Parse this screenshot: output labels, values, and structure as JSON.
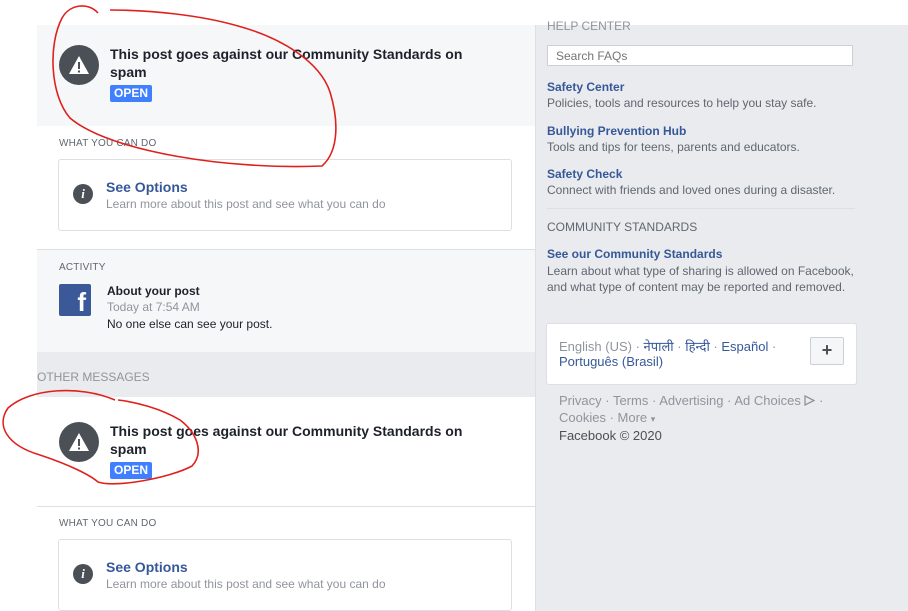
{
  "alerts": [
    {
      "title": "This post goes against our Community Standards on spam",
      "badge": "OPEN"
    },
    {
      "title": "This post goes against our Community Standards on spam",
      "badge": "OPEN"
    }
  ],
  "what_you_can_do_label": "WHAT YOU CAN DO",
  "options": {
    "title": "See Options",
    "subtitle": "Learn more about this post and see what you can do"
  },
  "activity": {
    "label": "ACTIVITY",
    "title": "About your post",
    "time": "Today at 7:54 AM",
    "text": "No one else can see your post."
  },
  "other_messages_label": "OTHER MESSAGES",
  "help_center": {
    "heading": "HELP CENTER",
    "search_placeholder": "Search FAQs",
    "links": [
      {
        "title": "Safety Center",
        "desc": "Policies, tools and resources to help you stay safe."
      },
      {
        "title": "Bullying Prevention Hub",
        "desc": "Tools and tips for teens, parents and educators."
      },
      {
        "title": "Safety Check",
        "desc": "Connect with friends and loved ones during a disaster."
      }
    ]
  },
  "community_standards": {
    "heading": "COMMUNITY STANDARDS",
    "link": "See our Community Standards",
    "desc": "Learn about what type of sharing is allowed on Facebook, and what type of content may be reported and removed."
  },
  "languages": {
    "current": "English (US)",
    "options": [
      "नेपाली",
      "हिन्दी",
      "Español",
      "Português (Brasil)"
    ],
    "separator": " · ",
    "add": "+"
  },
  "footer": {
    "links": [
      "Privacy",
      "Terms",
      "Advertising",
      "Ad Choices",
      "Cookies",
      "More"
    ],
    "separator": " · ",
    "more_caret": "▾",
    "copyright": "Facebook © 2020"
  },
  "colors": {
    "link": "#365899",
    "badge": "#4080ff",
    "annotation": "#e0201c"
  }
}
